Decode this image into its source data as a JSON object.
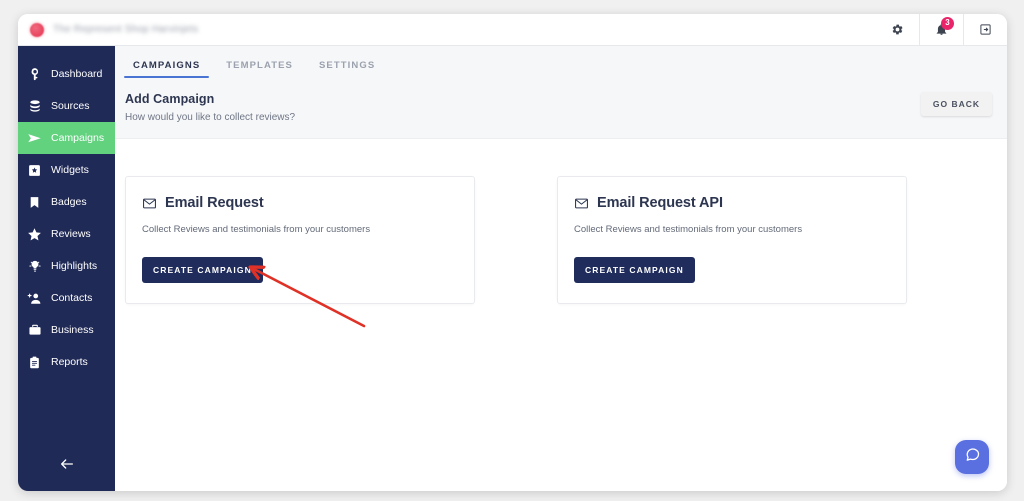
{
  "browser": {
    "tab_title": "The Represent Shop Harvinjets",
    "favicon": "circle-red-favicon",
    "icons": {
      "settings": "gear-icon",
      "notifications": "bell-icon",
      "notification_count": "3",
      "logout": "logout-icon"
    }
  },
  "sidebar": {
    "items": [
      {
        "label": "Dashboard",
        "icon": "dashboard-icon",
        "active": false
      },
      {
        "label": "Sources",
        "icon": "database-icon",
        "active": false
      },
      {
        "label": "Campaigns",
        "icon": "send-icon",
        "active": true
      },
      {
        "label": "Widgets",
        "icon": "widget-icon",
        "active": false
      },
      {
        "label": "Badges",
        "icon": "bookmark-icon",
        "active": false
      },
      {
        "label": "Reviews",
        "icon": "star-icon",
        "active": false
      },
      {
        "label": "Highlights",
        "icon": "lightbulb-icon",
        "active": false
      },
      {
        "label": "Contacts",
        "icon": "add-person-icon",
        "active": false
      },
      {
        "label": "Business",
        "icon": "briefcase-icon",
        "active": false
      },
      {
        "label": "Reports",
        "icon": "clipboard-icon",
        "active": false
      }
    ],
    "collapse_icon": "arrow-left-icon",
    "active_color": "#62d27f",
    "background_color": "#202a56"
  },
  "tabs": [
    {
      "label": "CAMPAIGNS",
      "active": true
    },
    {
      "label": "TEMPLATES",
      "active": false
    },
    {
      "label": "SETTINGS",
      "active": false
    }
  ],
  "page": {
    "title": "Add Campaign",
    "subtitle": "How would you like to collect reviews?",
    "go_back_label": "GO BACK"
  },
  "cards": [
    {
      "icon": "envelope-icon",
      "title": "Email Request",
      "description": "Collect Reviews and testimonials from your customers",
      "button_label": "CREATE CAMPAIGN"
    },
    {
      "icon": "envelope-icon",
      "title": "Email Request API",
      "description": "Collect Reviews and testimonials from your customers",
      "button_label": "CREATE CAMPAIGN"
    }
  ],
  "chat": {
    "icon": "chat-bubble-icon",
    "color": "#5a6fe0"
  },
  "annotation": {
    "type": "arrow",
    "color": "#e03127",
    "points_to": "create-campaign-button-card-1"
  }
}
